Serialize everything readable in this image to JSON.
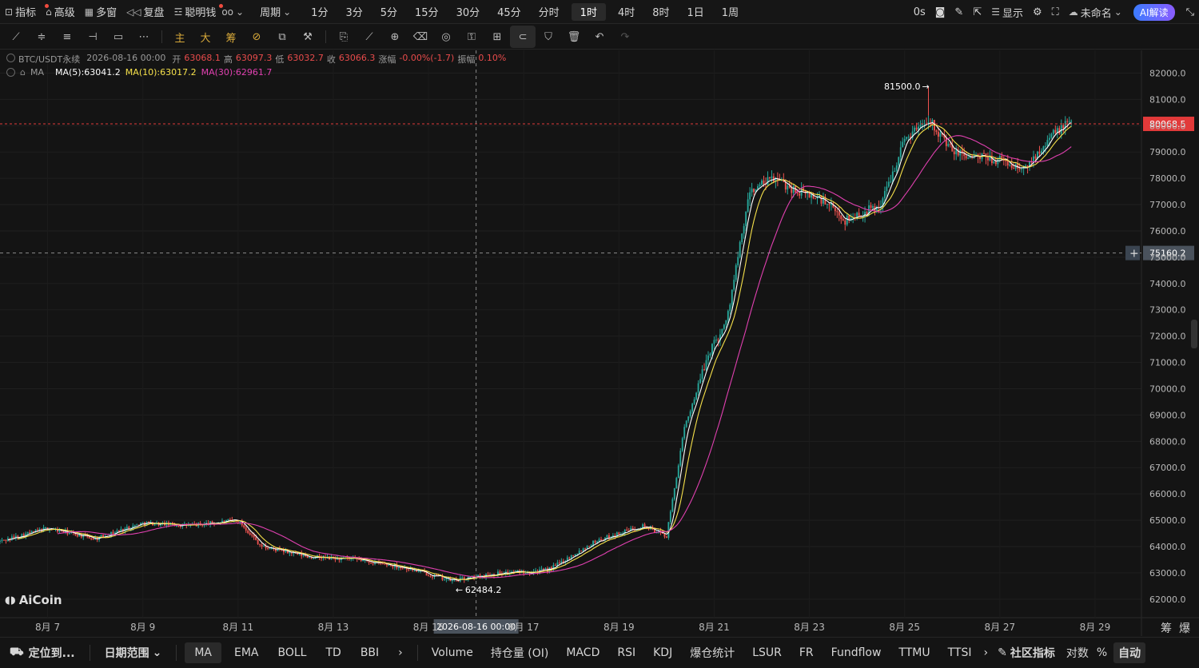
{
  "topbar": {
    "items": [
      {
        "label": "指标",
        "icon": "indicator-icon",
        "dot": true
      },
      {
        "label": "高级",
        "icon": "advanced-icon",
        "dot": false
      },
      {
        "label": "多窗",
        "icon": "grid-icon",
        "dot": false
      },
      {
        "label": "复盘",
        "icon": "replay-icon",
        "dot": false
      },
      {
        "label": "聪明钱",
        "icon": "smart-money-icon",
        "dot": true
      }
    ],
    "period_label": "周期",
    "periods": [
      "1分",
      "3分",
      "5分",
      "15分",
      "30分",
      "45分",
      "分时",
      "1时",
      "4时",
      "8时",
      "1日",
      "1周"
    ],
    "active_period": "1时",
    "countdown": "0s",
    "display_label": "显示",
    "layout_name": "未命名",
    "ai_label": "AI解读"
  },
  "legend": {
    "symbol": "BTC/USDT永续",
    "datetime": "2026-08-16 00:00",
    "open_label": "开",
    "open": "63068.1",
    "high_label": "高",
    "high": "63097.3",
    "low_label": "低",
    "low": "63032.7",
    "close_label": "收",
    "close": "63066.3",
    "change_label": "涨幅",
    "change": "-0.00%(-1.7)",
    "amp_label": "振幅",
    "amp": "0.10%",
    "ma_title": "MA",
    "ma5": "MA(5):63041.2",
    "ma10": "MA(10):63017.2",
    "ma30": "MA(30):62961.7"
  },
  "chart_data": {
    "type": "candlestick",
    "interval": "1h",
    "y_range": [
      61600,
      82500
    ],
    "y_ticks": [
      "82000.0",
      "81000.0",
      "80000.0",
      "79000.0",
      "78000.0",
      "77000.0",
      "76000.0",
      "75000.0",
      "74000.0",
      "73000.0",
      "72000.0",
      "71000.0",
      "70000.0",
      "69000.0",
      "68000.0",
      "67000.0",
      "66000.0",
      "65000.0",
      "64000.0",
      "63000.0",
      "62000.0"
    ],
    "x_ticks": [
      "8月 7",
      "8月 9",
      "8月 11",
      "8月 13",
      "8月 15",
      "8月 17",
      "8月 19",
      "8月 21",
      "8月 23",
      "8月 25",
      "8月 27",
      "8月 29"
    ],
    "price_path": [
      {
        "date": "2026-08-06 00:00",
        "price": 64200
      },
      {
        "date": "2026-08-07 00:00",
        "price": 64700
      },
      {
        "date": "2026-08-08 00:00",
        "price": 64300
      },
      {
        "date": "2026-08-09 00:00",
        "price": 64900
      },
      {
        "date": "2026-08-10 00:00",
        "price": 64800
      },
      {
        "date": "2026-08-11 00:00",
        "price": 65000
      },
      {
        "date": "2026-08-11 12:00",
        "price": 64000
      },
      {
        "date": "2026-08-12 12:00",
        "price": 63600
      },
      {
        "date": "2026-08-13 12:00",
        "price": 63500
      },
      {
        "date": "2026-08-14 12:00",
        "price": 63200
      },
      {
        "date": "2026-08-15 12:00",
        "price": 62700
      },
      {
        "date": "2026-08-16 12:00",
        "price": 63000
      },
      {
        "date": "2026-08-17 12:00",
        "price": 63100
      },
      {
        "date": "2026-08-18 12:00",
        "price": 64200
      },
      {
        "date": "2026-08-19 12:00",
        "price": 64800
      },
      {
        "date": "2026-08-20 00:00",
        "price": 64400
      },
      {
        "date": "2026-08-20 09:00",
        "price": 68500
      },
      {
        "date": "2026-08-20 22:00",
        "price": 71500
      },
      {
        "date": "2026-08-21 06:00",
        "price": 72500
      },
      {
        "date": "2026-08-21 18:00",
        "price": 77500
      },
      {
        "date": "2026-08-22 06:00",
        "price": 78000
      },
      {
        "date": "2026-08-22 18:00",
        "price": 77500
      },
      {
        "date": "2026-08-23 06:00",
        "price": 77200
      },
      {
        "date": "2026-08-23 18:00",
        "price": 76400
      },
      {
        "date": "2026-08-24 12:00",
        "price": 77000
      },
      {
        "date": "2026-08-25 00:00",
        "price": 79500
      },
      {
        "date": "2026-08-25 12:00",
        "price": 80300
      },
      {
        "date": "2026-08-26 00:00",
        "price": 79000
      },
      {
        "date": "2026-08-26 12:00",
        "price": 78800
      },
      {
        "date": "2026-08-27 00:00",
        "price": 78700
      },
      {
        "date": "2026-08-27 12:00",
        "price": 78300
      },
      {
        "date": "2026-08-28 00:00",
        "price": 79500
      },
      {
        "date": "2026-08-28 12:00",
        "price": 80200
      }
    ],
    "high_marker": "81500.0",
    "low_marker": "62484.2",
    "last_price": "80068.5",
    "crosshair_price": "75160.2",
    "crosshair_time": "2026-08-16 00:00",
    "colors": {
      "up": "#26a69a",
      "down": "#ef5350",
      "ma5": "#ffffff",
      "ma10": "#f5e04a",
      "ma30": "#e040b0",
      "last": "#e23a3a"
    }
  },
  "watermark": "AiCoin",
  "right_labels": {
    "chip": "筹",
    "liq": "爆"
  },
  "bottombar": {
    "locate": "定位到...",
    "date_range": "日期范围",
    "main_indicators": [
      "MA",
      "EMA",
      "BOLL",
      "TD",
      "BBI"
    ],
    "active_main": "MA",
    "sub_indicators": [
      "Volume",
      "持仓量 (OI)",
      "MACD",
      "RSI",
      "KDJ",
      "爆仓统计",
      "LSUR",
      "FR",
      "Fundflow",
      "TTMU",
      "TTSI"
    ],
    "community": "社区指标",
    "log_label": "对数",
    "percent_label": "%",
    "auto_label": "自动"
  }
}
